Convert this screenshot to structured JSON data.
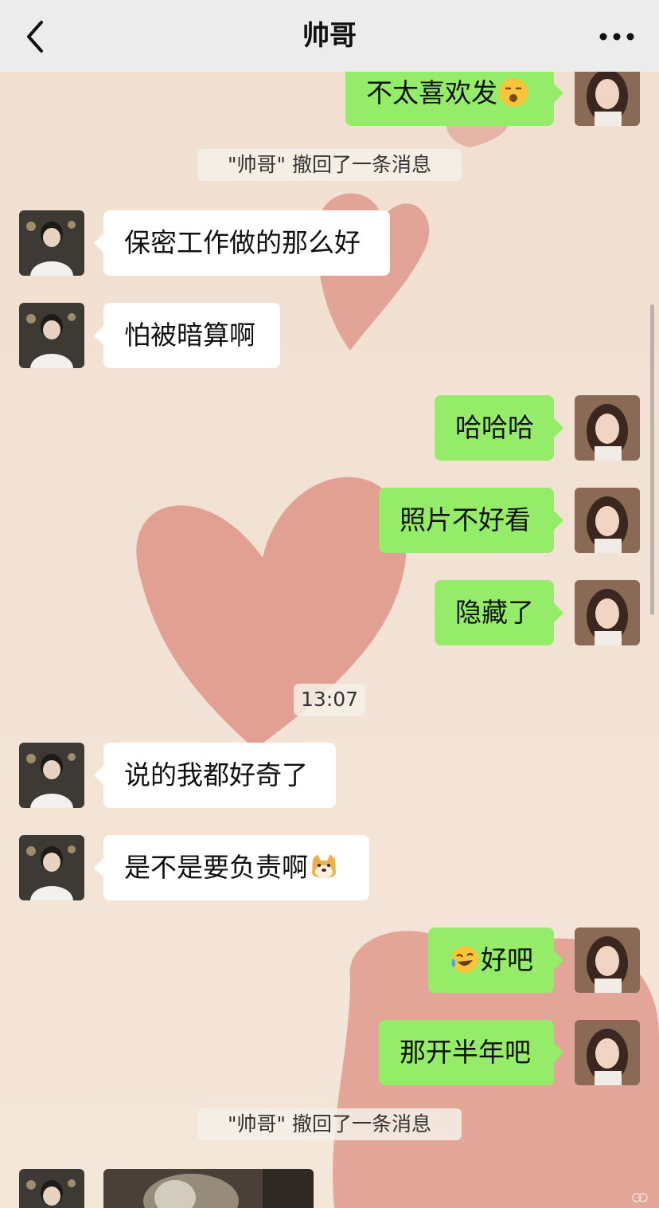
{
  "header": {
    "title": "帅哥",
    "back_icon": "chevron-left-icon",
    "more_icon": "more-dots-icon"
  },
  "system": {
    "recall_1": "\"帅哥\" 撤回了一条消息",
    "time_1": "13:07",
    "recall_2": "\"帅哥\" 撤回了一条消息"
  },
  "messages": [
    {
      "from": "me",
      "text": "不太喜欢发",
      "emoji": "sleepy-face-emoji"
    },
    {
      "from": "other",
      "text": "保密工作做的那么好"
    },
    {
      "from": "other",
      "text": "怕被暗算啊"
    },
    {
      "from": "me",
      "text": "哈哈哈"
    },
    {
      "from": "me",
      "text": "照片不好看"
    },
    {
      "from": "me",
      "text": "隐藏了"
    },
    {
      "from": "other",
      "text": "说的我都好奇了"
    },
    {
      "from": "other",
      "text": "是不是要负责啊",
      "emoji": "doge-emoji"
    },
    {
      "from": "me",
      "text": "好吧",
      "emoji": "laugh-cry-emoji"
    },
    {
      "from": "me",
      "text": "那开半年吧"
    }
  ],
  "colors": {
    "outgoing_bubble": "#95ec69",
    "incoming_bubble": "#ffffff",
    "header_bg": "#ececec",
    "wallpaper": "#f3e3d6",
    "heart": "#dc8a7c"
  }
}
